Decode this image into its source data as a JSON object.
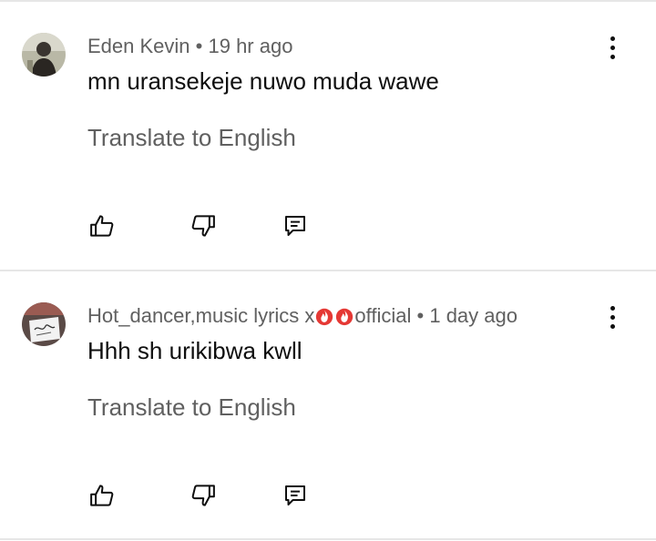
{
  "comments": [
    {
      "author": "Eden Kevin",
      "separator": "•",
      "time": "19 hr ago",
      "text": "mn uransekeje nuwo muda wawe",
      "translate_label": "Translate to English",
      "avatar_icon": "user-photo-avatar"
    },
    {
      "author_prefix": "Hot_dancer,music lyrics x",
      "author_emojis": [
        "fire-emoji",
        "fire-emoji"
      ],
      "author_suffix": "official",
      "separator": "•",
      "time": "1 day ago",
      "text": "Hhh sh urikibwa kwll",
      "translate_label": "Translate to English",
      "avatar_icon": "logo-avatar"
    }
  ],
  "actions": {
    "like_icon": "thumbs-up-icon",
    "dislike_icon": "thumbs-down-icon",
    "reply_icon": "reply-icon",
    "more_icon": "more-vertical-icon"
  },
  "colors": {
    "meta_text": "#606060",
    "body_text": "#0f0f0f",
    "divider": "#e6e6e6",
    "fire": "#e53935"
  }
}
